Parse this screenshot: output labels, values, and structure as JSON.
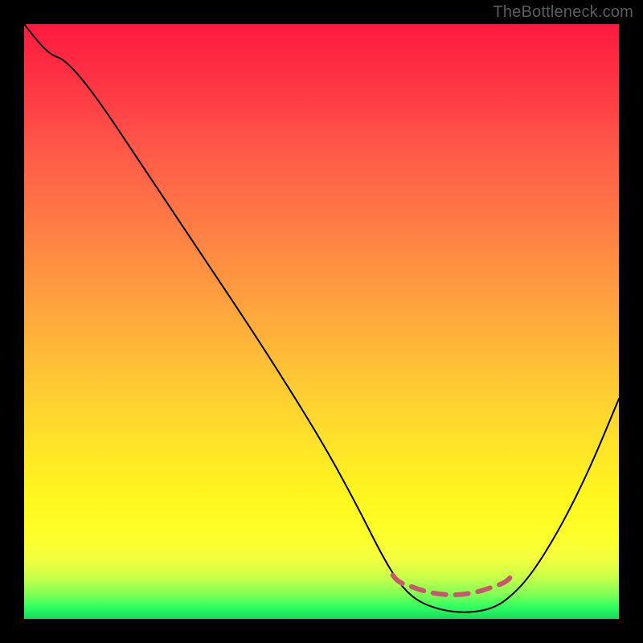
{
  "watermark": "TheBottleneck.com",
  "colors": {
    "background": "#000000",
    "curve": "#000000",
    "dashes": "#c7576d",
    "gradient_stops": [
      "#ff1a3c",
      "#ff5548",
      "#ff9f3f",
      "#ffe22a",
      "#fdff2a",
      "#7dff55",
      "#18d85a"
    ]
  },
  "chart_data": {
    "type": "line",
    "x_range": [
      0,
      100
    ],
    "y_range": [
      0,
      100
    ],
    "note": "Bottleneck-percentage style curve. y≈0 is best (green, bottom), y≈100 is worst (red, top). x is a normalized component-performance axis. The dashed segment marks the optimal zone where the curve is near 0.",
    "curve": [
      {
        "x": 0,
        "y": 100
      },
      {
        "x": 4,
        "y": 95
      },
      {
        "x": 7,
        "y": 94
      },
      {
        "x": 12,
        "y": 88
      },
      {
        "x": 20,
        "y": 76
      },
      {
        "x": 30,
        "y": 61
      },
      {
        "x": 40,
        "y": 46
      },
      {
        "x": 50,
        "y": 30
      },
      {
        "x": 56,
        "y": 19
      },
      {
        "x": 60,
        "y": 11
      },
      {
        "x": 63,
        "y": 6
      },
      {
        "x": 66,
        "y": 3
      },
      {
        "x": 70,
        "y": 1.5
      },
      {
        "x": 74,
        "y": 1
      },
      {
        "x": 78,
        "y": 1.5
      },
      {
        "x": 81,
        "y": 3
      },
      {
        "x": 85,
        "y": 7
      },
      {
        "x": 90,
        "y": 15
      },
      {
        "x": 95,
        "y": 25
      },
      {
        "x": 100,
        "y": 37
      }
    ],
    "optimal_zone": {
      "x_start": 62,
      "x_end": 82,
      "y_approx": 6
    }
  }
}
